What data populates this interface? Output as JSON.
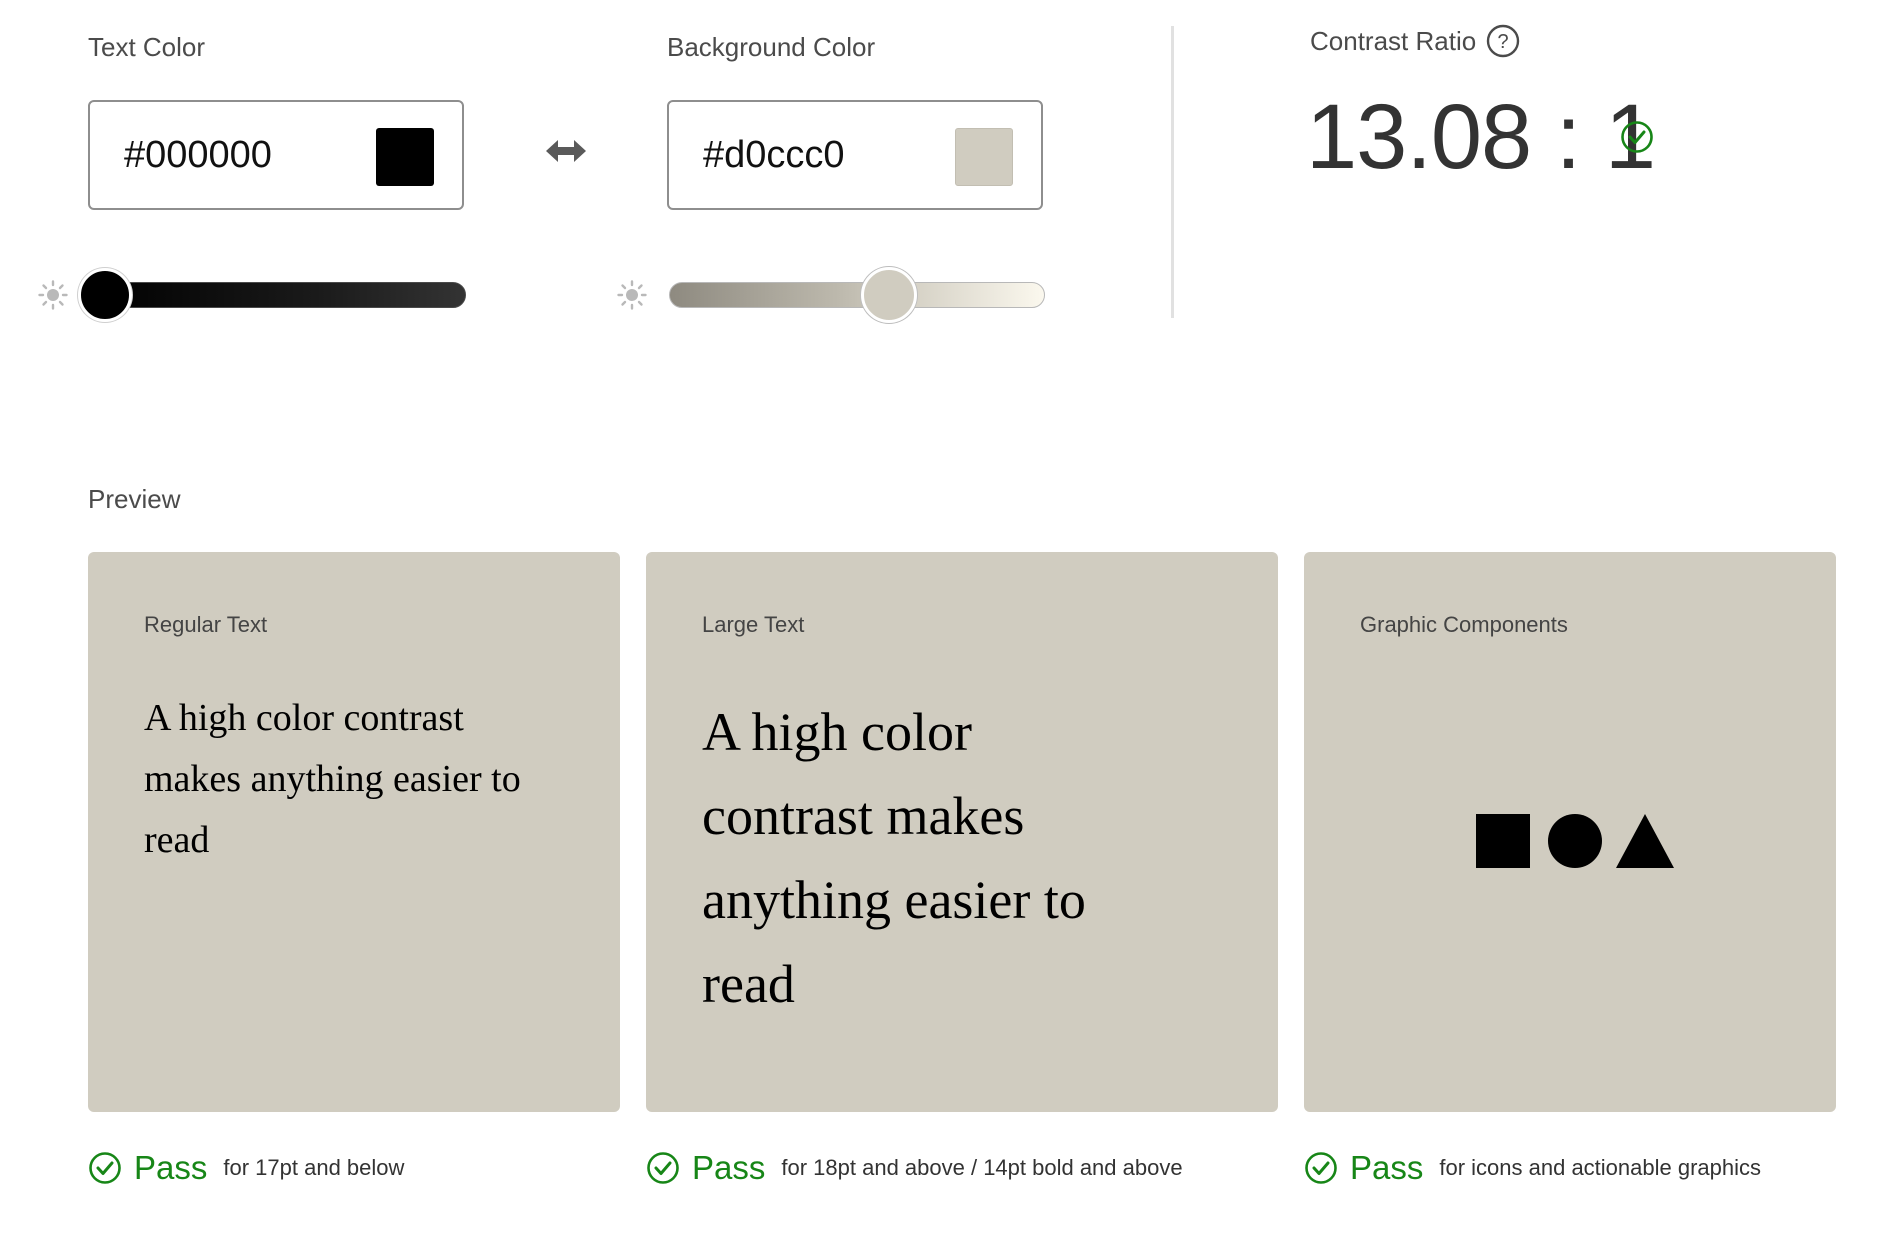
{
  "text_color": {
    "label": "Text Color",
    "value": "#000000",
    "swatch": "#000000",
    "lightness_icon": "sun-icon",
    "slider_level": 0.05
  },
  "swap_icon": "swap-arrows-icon",
  "background_color": {
    "label": "Background Color",
    "value": "#d0ccc0",
    "swatch": "#d0ccc0",
    "lightness_icon": "sun-icon",
    "slider_level": 0.58
  },
  "contrast": {
    "label": "Contrast Ratio",
    "help_icon": "question-circle-icon",
    "value": "13.08 : 1",
    "status_icon": "check-circle-icon",
    "status_color": "#178617"
  },
  "preview": {
    "label": "Preview",
    "panels": [
      {
        "label": "Regular Text",
        "sample_text": "A high color contrast makes anything easier to read",
        "result": "Pass",
        "note": "for 17pt and below"
      },
      {
        "label": "Large Text",
        "sample_text": "A high color contrast makes anything easier to read",
        "result": "Pass",
        "note": "for 18pt and above / 14pt bold and above"
      },
      {
        "label": "Graphic Components",
        "shapes": [
          "square-icon",
          "circle-icon",
          "triangle-icon"
        ],
        "result": "Pass",
        "note": "for icons and actionable graphics"
      }
    ]
  }
}
